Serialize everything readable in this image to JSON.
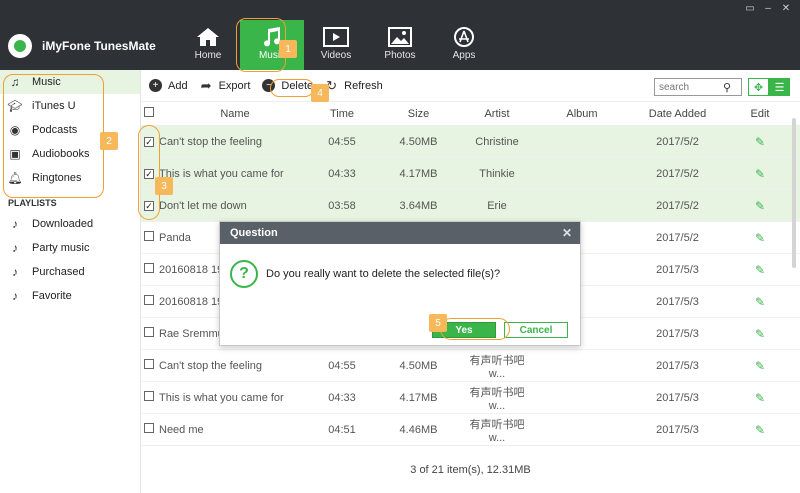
{
  "app": {
    "name": "iMyFone TunesMate"
  },
  "window_controls": [
    "▭",
    "–",
    "✕"
  ],
  "nav": [
    {
      "label": "Home",
      "icon": "home-icon",
      "active": false
    },
    {
      "label": "Music",
      "icon": "music-note-icon",
      "active": true
    },
    {
      "label": "Videos",
      "icon": "video-icon",
      "active": false
    },
    {
      "label": "Photos",
      "icon": "photo-icon",
      "active": false
    },
    {
      "label": "Apps",
      "icon": "apps-icon",
      "active": false
    }
  ],
  "sidebar": {
    "items": [
      {
        "label": "Music",
        "icon": "music-note-icon",
        "active": true
      },
      {
        "label": "iTunes U",
        "icon": "graduation-cap-icon",
        "active": false
      },
      {
        "label": "Podcasts",
        "icon": "podcast-icon",
        "active": false
      },
      {
        "label": "Audiobooks",
        "icon": "audiobook-icon",
        "active": false
      },
      {
        "label": "Ringtones",
        "icon": "bell-icon",
        "active": false
      }
    ],
    "section_title": "PLAYLISTS",
    "playlists": [
      {
        "label": "Downloaded",
        "icon": "music-note-icon"
      },
      {
        "label": "Party music",
        "icon": "music-note-icon"
      },
      {
        "label": "Purchased",
        "icon": "music-note-icon"
      },
      {
        "label": "Favorite",
        "icon": "music-note-icon"
      }
    ]
  },
  "toolbar": {
    "add": "Add",
    "export": "Export",
    "delete": "Delete",
    "refresh": "Refresh",
    "search_placeholder": "search"
  },
  "table": {
    "columns": [
      "Name",
      "Time",
      "Size",
      "Artist",
      "Album",
      "Date Added",
      "Edit"
    ],
    "rows": [
      {
        "checked": true,
        "selected": true,
        "name": "Can't stop the feeling",
        "time": "04:55",
        "size": "4.50MB",
        "artist": "Christine",
        "album": "",
        "date": "2017/5/2"
      },
      {
        "checked": true,
        "selected": true,
        "name": "This is what you came for",
        "time": "04:33",
        "size": "4.17MB",
        "artist": "Thinkie",
        "album": "",
        "date": "2017/5/2"
      },
      {
        "checked": true,
        "selected": true,
        "name": "Don't let me down",
        "time": "03:58",
        "size": "3.64MB",
        "artist": "Erie",
        "album": "",
        "date": "2017/5/2"
      },
      {
        "checked": false,
        "selected": false,
        "name": "Panda",
        "time": "",
        "size": "",
        "artist": "",
        "album": "",
        "date": "2017/5/2"
      },
      {
        "checked": false,
        "selected": false,
        "name": "20160818 19",
        "time": "",
        "size": "",
        "artist": "",
        "album": "",
        "date": "2017/5/3"
      },
      {
        "checked": false,
        "selected": false,
        "name": "20160818 19",
        "time": "",
        "size": "",
        "artist": "",
        "album": "",
        "date": "2017/5/3"
      },
      {
        "checked": false,
        "selected": false,
        "name": "Rae Sremmu",
        "time": "",
        "size": "",
        "artist": "",
        "album": "",
        "date": "2017/5/3"
      },
      {
        "checked": false,
        "selected": false,
        "name": "Can't stop the feeling",
        "time": "04:55",
        "size": "4.50MB",
        "artist": "有声听书吧 w...",
        "album": "",
        "date": "2017/5/3"
      },
      {
        "checked": false,
        "selected": false,
        "name": "This is what you came for",
        "time": "04:33",
        "size": "4.17MB",
        "artist": "有声听书吧 w...",
        "album": "",
        "date": "2017/5/3"
      },
      {
        "checked": false,
        "selected": false,
        "name": "Need me",
        "time": "04:51",
        "size": "4.46MB",
        "artist": "有声听书吧 w...",
        "album": "",
        "date": "2017/5/3"
      }
    ]
  },
  "footer": {
    "status": "3 of 21 item(s), 12.31MB"
  },
  "dialog": {
    "title": "Question",
    "message": "Do you really want to delete the selected file(s)?",
    "yes": "Yes",
    "cancel": "Cancel"
  },
  "annotations": [
    "1",
    "2",
    "3",
    "4",
    "5"
  ],
  "colors": {
    "accent": "#3ab54a",
    "topbar": "#2e3136",
    "highlight": "#f0a030"
  }
}
